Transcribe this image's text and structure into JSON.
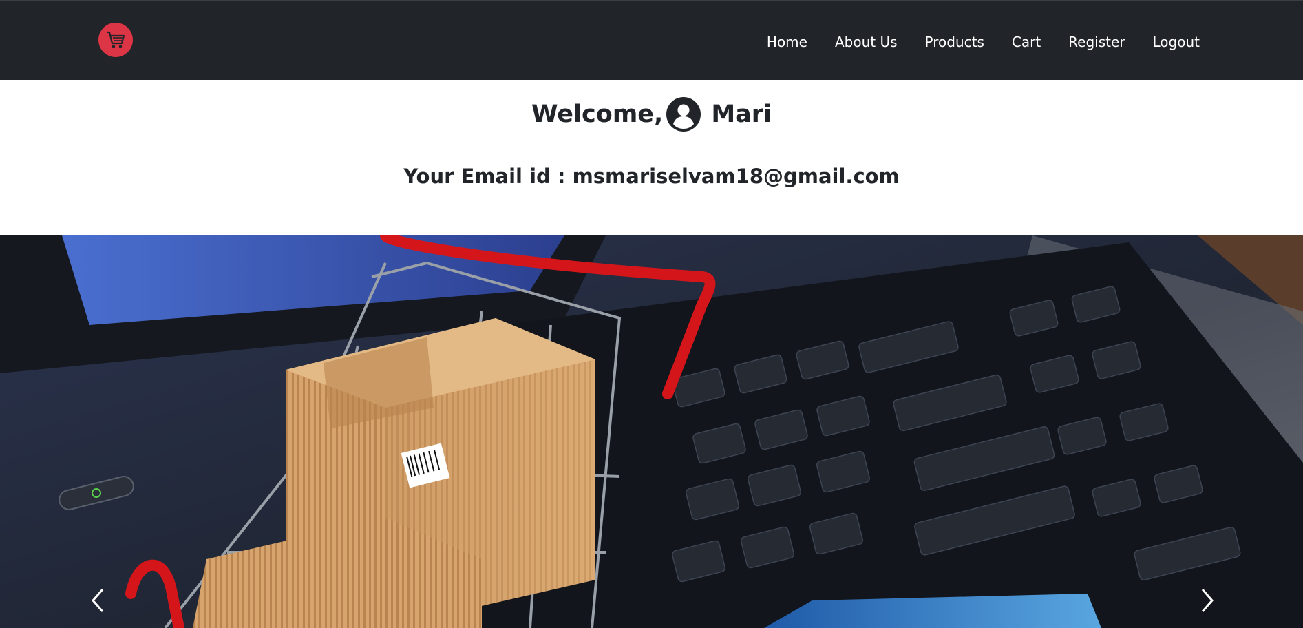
{
  "brand": {
    "logo_icon": "shopping-cart-icon",
    "accent": "#dc3545"
  },
  "nav": {
    "items": [
      {
        "label": "Home"
      },
      {
        "label": "About Us"
      },
      {
        "label": "Products"
      },
      {
        "label": "Cart"
      },
      {
        "label": "Register"
      },
      {
        "label": "Logout"
      }
    ]
  },
  "welcome": {
    "prefix": "Welcome,",
    "avatar_icon": "user-circle-icon",
    "username": "Mari"
  },
  "email": {
    "text": "Your Email id : msmariselvam18@gmail.com"
  },
  "carousel": {
    "image": "shopping-cart-on-laptop-keyboard",
    "prev_icon": "chevron-left-icon",
    "next_icon": "chevron-right-icon"
  }
}
